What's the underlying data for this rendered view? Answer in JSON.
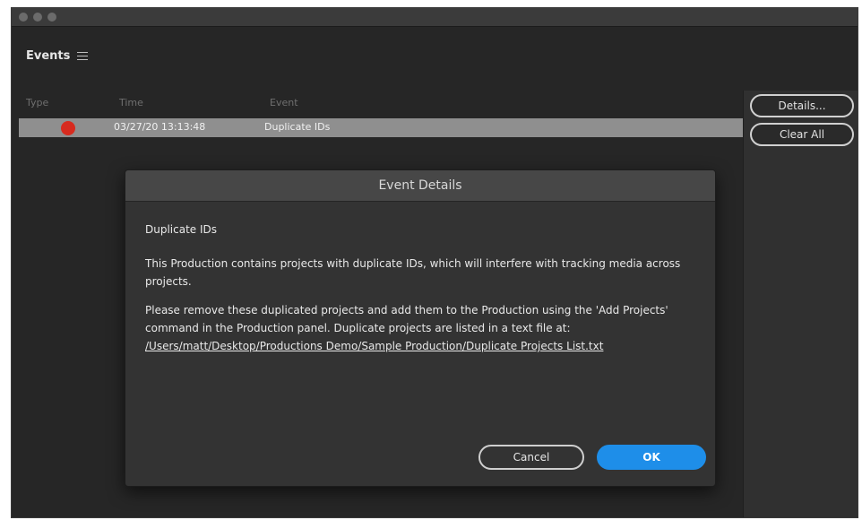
{
  "panel": {
    "title": "Events"
  },
  "columns": {
    "type": "Type",
    "time": "Time",
    "event": "Event"
  },
  "events": [
    {
      "type_color": "#d72b1f",
      "time": "03/27/20 13:13:48",
      "event": "Duplicate IDs"
    }
  ],
  "side_buttons": {
    "details": "Details...",
    "clear_all": "Clear All"
  },
  "dialog": {
    "title": "Event Details",
    "heading": "Duplicate IDs",
    "paragraph1": "This Production contains projects with duplicate IDs, which will interfere with tracking media across projects.",
    "paragraph2": "Please remove these duplicated projects and add them to the Production using the 'Add Projects' command in the Production panel. Duplicate projects are listed in a text file at:",
    "path": "/Users/matt/Desktop/Productions Demo/Sample Production/Duplicate Projects List.txt",
    "cancel_label": "Cancel",
    "ok_label": "OK"
  },
  "colors": {
    "accent": "#1e8ee9",
    "error": "#d72b1f",
    "background": "#262626"
  }
}
